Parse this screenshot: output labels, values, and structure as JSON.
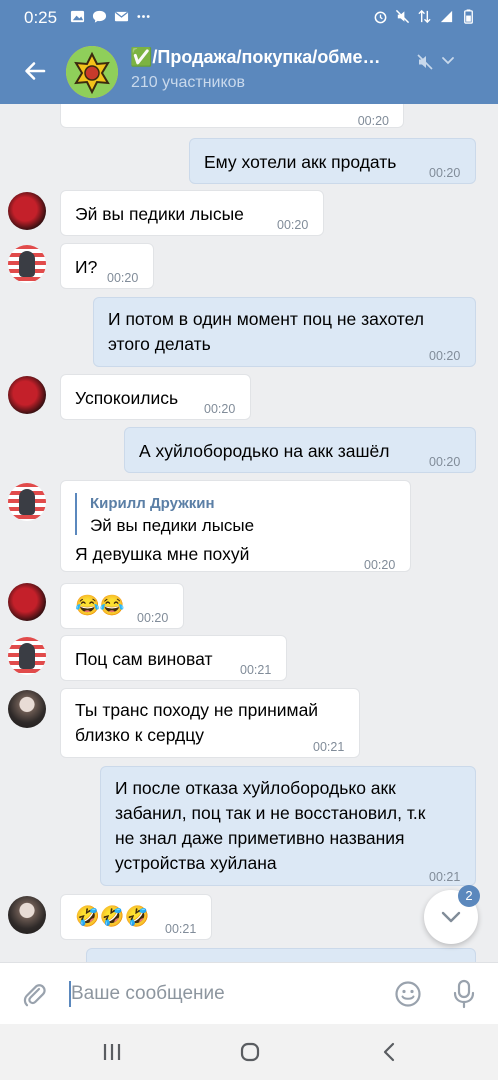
{
  "status_bar": {
    "time": "0:25"
  },
  "header": {
    "title": "✅/Продажа/покупка/обме…",
    "subtitle": "210 участников"
  },
  "messages": [
    {
      "id": "m0",
      "side": "in",
      "text": "",
      "time": "00:20"
    },
    {
      "id": "m1",
      "side": "out",
      "text": "Ему хотели акк продать",
      "time": "00:20"
    },
    {
      "id": "m2",
      "side": "in",
      "avatar": "red",
      "text": "Эй вы педики лысые",
      "time": "00:20"
    },
    {
      "id": "m3",
      "side": "in",
      "avatar": "flag",
      "text": "И?",
      "time": "00:20"
    },
    {
      "id": "m4",
      "side": "out",
      "lines": [
        "И потом в один момент поц не захотел",
        "этого делать"
      ],
      "time": "00:20"
    },
    {
      "id": "m5",
      "side": "in",
      "avatar": "red",
      "text": "Успокоились",
      "time": "00:20"
    },
    {
      "id": "m6",
      "side": "out",
      "text": "А хуйлобородько на акк зашёл",
      "time": "00:20"
    },
    {
      "id": "m7",
      "side": "in",
      "avatar": "flag",
      "reply": {
        "author": "Кирилл Дружкин",
        "text": "Эй вы педики лысые"
      },
      "text": "Я девушка мне похуй",
      "time": "00:20"
    },
    {
      "id": "m8",
      "side": "in",
      "avatar": "red",
      "text": "😂😂",
      "time": "00:20"
    },
    {
      "id": "m9",
      "side": "in",
      "avatar": "flag",
      "text": "Поц сам виноват",
      "time": "00:21"
    },
    {
      "id": "m10",
      "side": "in",
      "avatar": "bw",
      "lines": [
        "Ты транс походу не принимай",
        "близко к сердцу"
      ],
      "time": "00:21"
    },
    {
      "id": "m11",
      "side": "out",
      "lines": [
        "И после отказа хуйлобородько акк",
        "забанил, поц так и не восстановил, т.к",
        "не знал даже приметивно названия",
        "устройства хуйлана"
      ],
      "time": "00:21"
    },
    {
      "id": "m12",
      "side": "in",
      "avatar": "bw",
      "text": "🤣🤣🤣",
      "time": "00:21"
    }
  ],
  "scroll_down": {
    "unread_count": "2"
  },
  "composer": {
    "placeholder": "Ваше сообщение"
  },
  "colors": {
    "header": "#5b88bd",
    "outgoing_bubble": "#dce8f5",
    "incoming_bubble": "#ffffff",
    "background": "#edeef0"
  },
  "icons": [
    "back-arrow-icon",
    "mute-icon",
    "chevron-down-icon",
    "paperclip-icon",
    "smile-icon",
    "microphone-icon",
    "recent-apps-icon",
    "home-icon",
    "nav-back-icon"
  ]
}
